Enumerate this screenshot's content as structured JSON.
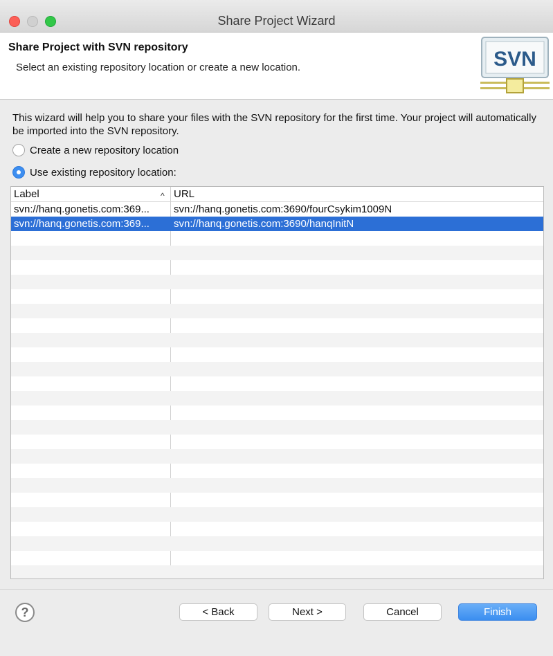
{
  "window": {
    "title": "Share Project Wizard"
  },
  "header": {
    "title": "Share Project with SVN repository",
    "subtitle": "Select an existing repository location or create a new location.",
    "logo_text": "SVN"
  },
  "body": {
    "description": "This wizard will help you to share your files with the SVN repository for the first time. Your project will automatically be imported into the SVN repository.",
    "options": {
      "create_new": {
        "label": "Create a new repository location",
        "checked": false
      },
      "use_existing": {
        "label": "Use existing repository location:",
        "checked": true
      }
    },
    "table": {
      "columns": {
        "label": "Label",
        "url": "URL"
      },
      "sort_icon": "chevron-up-icon",
      "rows": [
        {
          "label": "svn://hanq.gonetis.com:369...",
          "url": "svn://hanq.gonetis.com:3690/fourCsykim1009N",
          "selected": false
        },
        {
          "label": "svn://hanq.gonetis.com:369...",
          "url": "svn://hanq.gonetis.com:3690/hanqInitN",
          "selected": true
        }
      ]
    }
  },
  "footer": {
    "help_icon": "help-icon",
    "back_label": "< Back",
    "next_label": "Next >",
    "cancel_label": "Cancel",
    "finish_label": "Finish"
  },
  "colors": {
    "selection": "#2c6fd6",
    "primary_button": "#3b8ef0",
    "radio_checked": "#3d8ef0"
  }
}
